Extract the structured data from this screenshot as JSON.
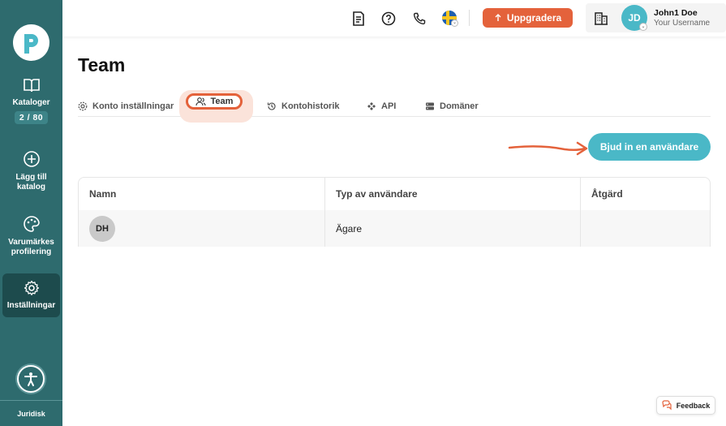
{
  "sidebar": {
    "logo_letter": "P",
    "items": [
      {
        "label": "Kataloger",
        "icon": "book-open-icon",
        "badge": "2 / 80"
      },
      {
        "label": "Lägg till katalog",
        "icon": "plus-circle-icon"
      },
      {
        "label": "Varumärkes profilering",
        "icon": "palette-icon"
      },
      {
        "label": "Inställningar",
        "icon": "gear-icon"
      }
    ],
    "legal": "Juridisk",
    "colors": {
      "bg": "#2e6b6e",
      "active": "#1d4b4d"
    }
  },
  "topbar": {
    "upgrade_label": "Uppgradera",
    "user": {
      "initials": "JD",
      "name": "John1 Doe",
      "sub": "Your Username"
    },
    "icons": [
      "document-icon",
      "help-icon",
      "phone-icon",
      "flag-sweden-icon",
      "building-icon"
    ]
  },
  "page": {
    "title": "Team",
    "tabs": [
      {
        "label": "Konto inställningar",
        "icon": "gear-icon"
      },
      {
        "label": "Team",
        "icon": "users-icon",
        "active": true
      },
      {
        "label": "Kontohistorik",
        "icon": "history-icon"
      },
      {
        "label": "API",
        "icon": "api-icon"
      },
      {
        "label": "Domäner",
        "icon": "server-icon"
      }
    ],
    "invite_label": "Bjud in en användare",
    "table": {
      "headers": [
        "Namn",
        "Typ av användare",
        "Åtgärd"
      ],
      "rows": [
        {
          "initials": "DH",
          "type": "Ägare",
          "action": ""
        }
      ]
    }
  },
  "feedback_label": "Feedback",
  "colors": {
    "accent_orange": "#e4623b",
    "accent_teal": "#4ab8c7"
  }
}
